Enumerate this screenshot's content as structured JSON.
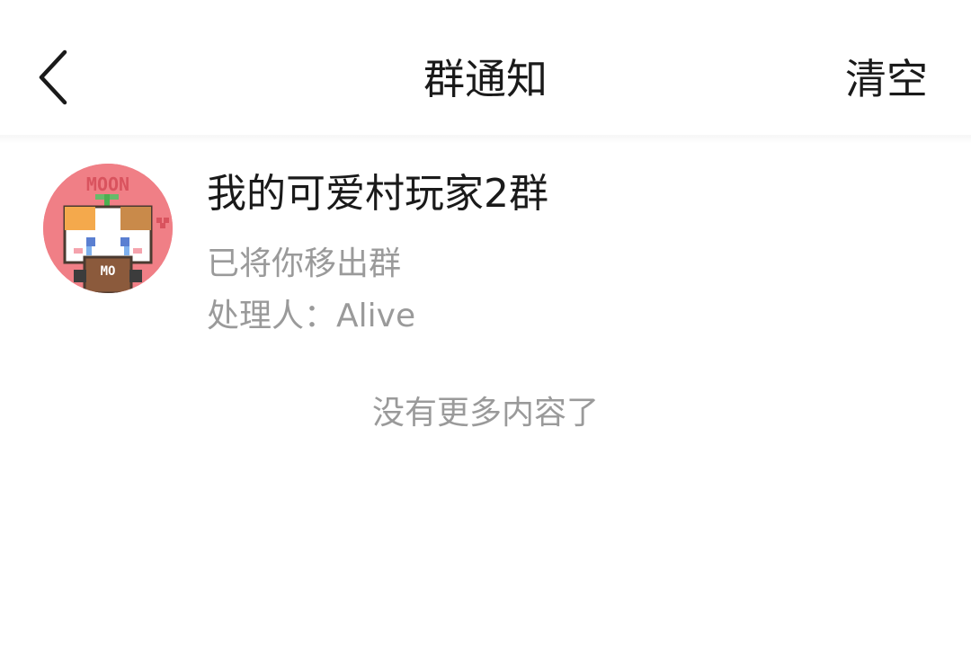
{
  "header": {
    "back_icon": "chevron-left-icon",
    "title": "群通知",
    "clear_label": "清空"
  },
  "notices": [
    {
      "group_name": "我的可爱村玩家2群",
      "action": "已将你移出群",
      "handler_label": "处理人：",
      "handler_name": "Alive",
      "avatar": {
        "description_icon": "cat-avatar-icon",
        "text_top": "MOON",
        "text_cup": "MO",
        "bg_color": "#f07f86"
      }
    }
  ],
  "footer": {
    "end_text": "没有更多内容了"
  },
  "colors": {
    "primary_text": "#1a1a1a",
    "secondary_text": "#9a9a9a",
    "background": "#ffffff"
  }
}
